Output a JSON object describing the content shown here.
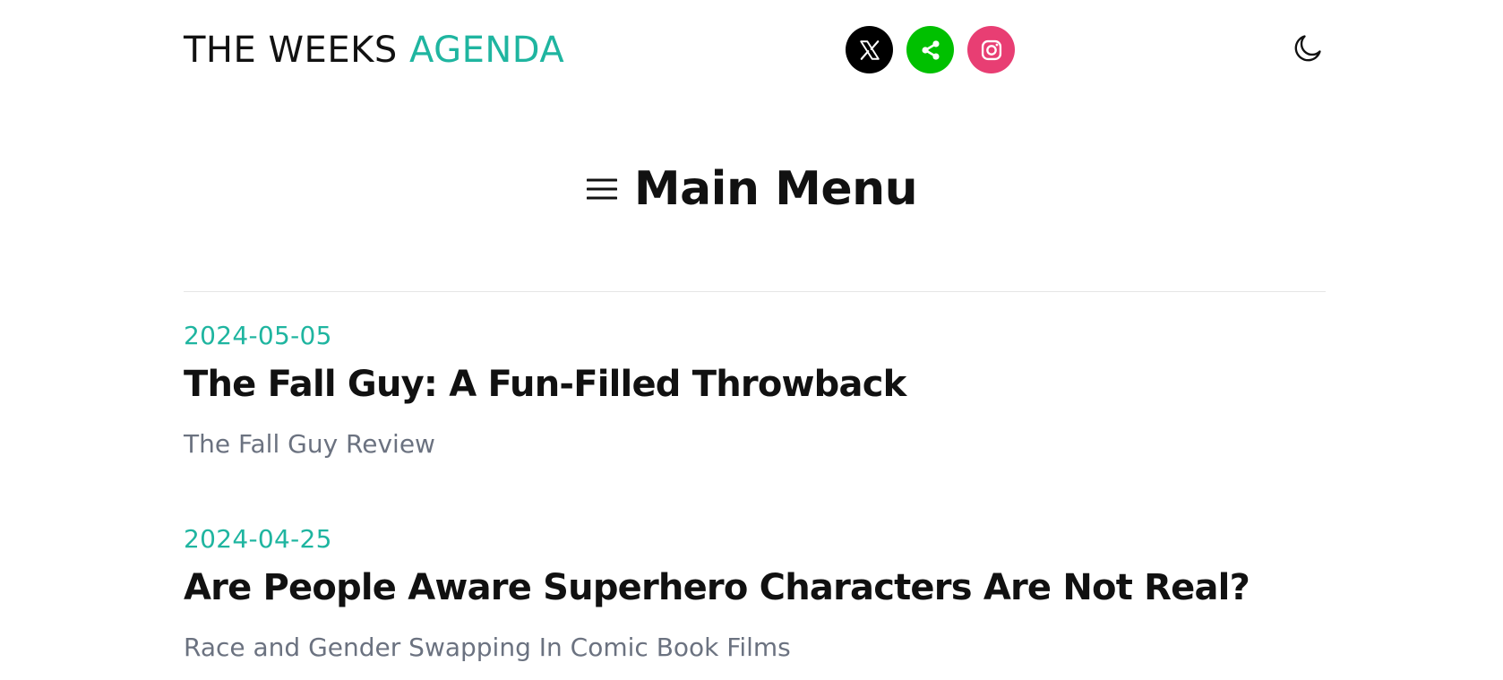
{
  "header": {
    "logo": {
      "part1": "THE WEEKS ",
      "part2": "AGENDA"
    },
    "social": [
      {
        "icon": "x-icon",
        "bg": "#000000"
      },
      {
        "icon": "share-icon",
        "bg": "#00c000"
      },
      {
        "icon": "instagram-icon",
        "bg": "#e83e73"
      }
    ],
    "theme_toggle_icon": "moon-icon"
  },
  "menu": {
    "icon": "hamburger-menu-icon",
    "title": "Main Menu"
  },
  "posts": [
    {
      "date": "2024-05-05",
      "title": "The Fall Guy: A Fun-Filled Throwback",
      "subtitle": "The Fall Guy Review"
    },
    {
      "date": "2024-04-25",
      "title": "Are People Aware Superhero Characters Are Not Real?",
      "subtitle": "Race and Gender Swapping In Comic Book Films"
    }
  ],
  "colors": {
    "accent": "#1fb5a0",
    "text": "#111111",
    "muted": "#6b7280",
    "divider": "#e6e6e6"
  }
}
